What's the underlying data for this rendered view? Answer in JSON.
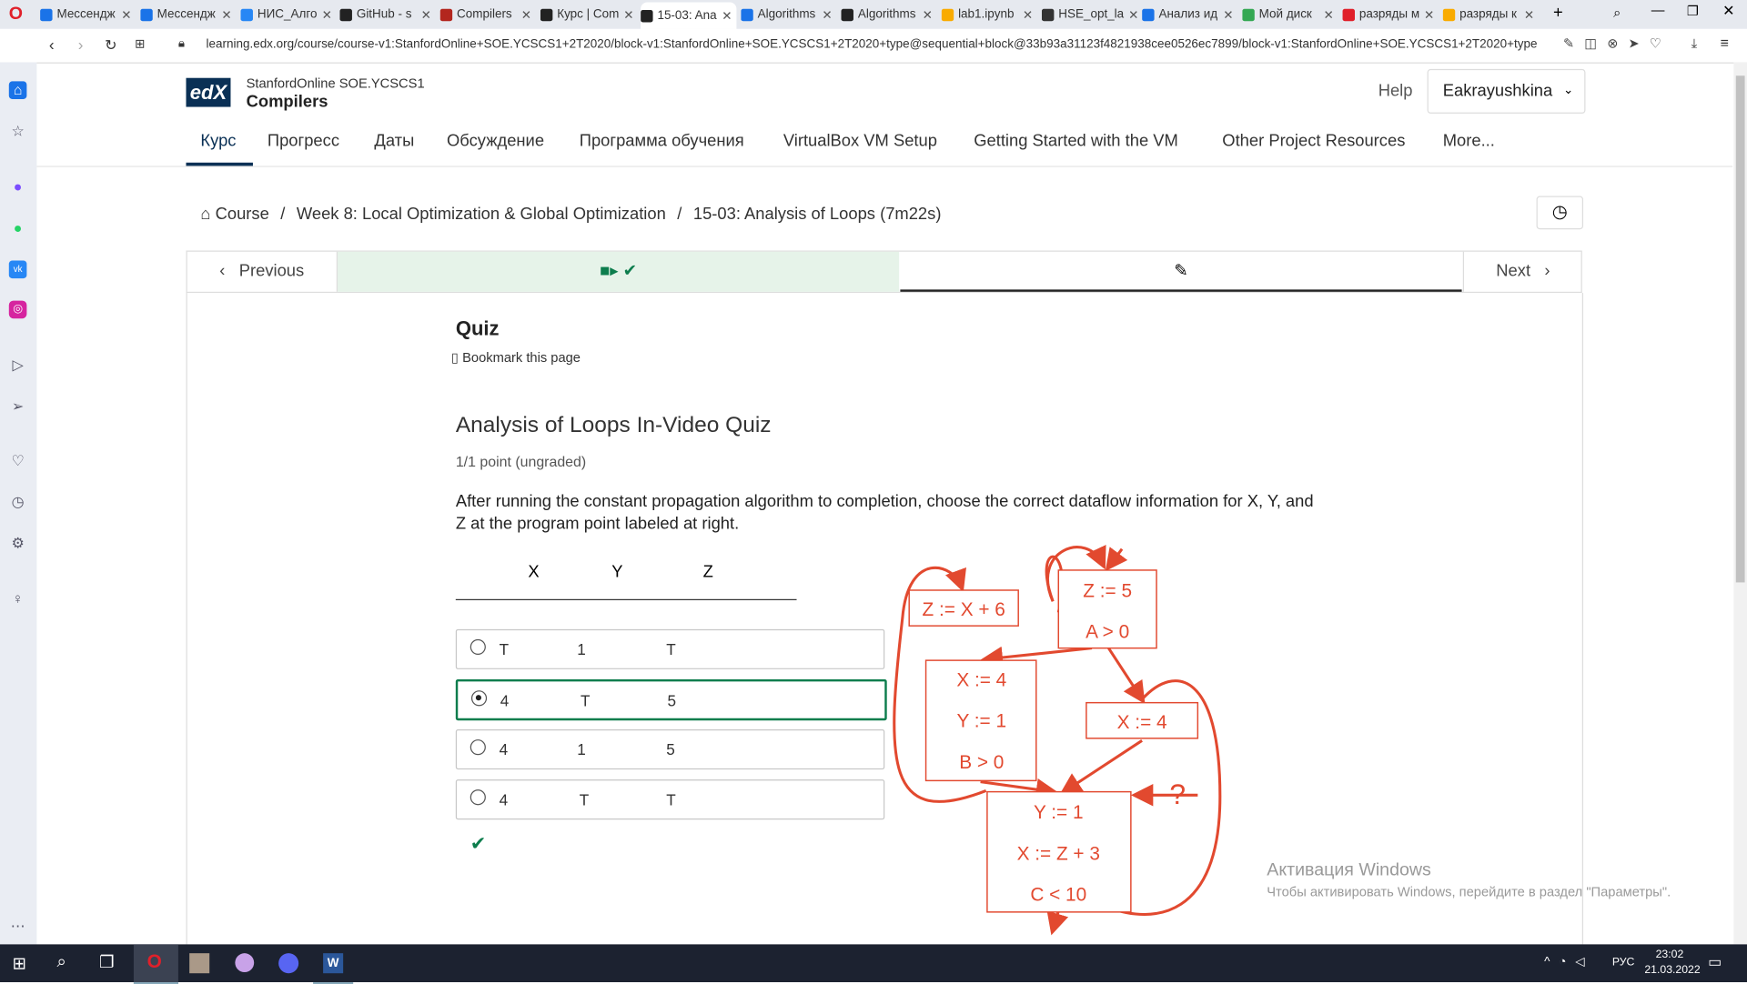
{
  "browser": {
    "tabs": [
      "Мессендж",
      "Мессендж",
      "НИС_Алго",
      "GitHub - s",
      "Compilers",
      "Курс | Com",
      "15-03: Ana",
      "Algorithms",
      "Algorithms",
      "lab1.ipynb",
      "HSE_opt_la",
      "Анализ ид",
      "Мой диск",
      "разряды м",
      "разряды к"
    ],
    "url": "learning.edx.org/course/course-v1:StanfordOnline+SOE.YCSCS1+2T2020/block-v1:StanfordOnline+SOE.YCSCS1+2T2020+type@sequential+block@33b93a31123f4821938cee0526ec7899/block-v1:StanfordOnline+SOE.YCSCS1+2T2020+type"
  },
  "header": {
    "logo": "edX",
    "org": "StanfordOnline SOE.YCSCS1",
    "course": "Compilers",
    "help": "Help",
    "user": "Eakrayushkina"
  },
  "nav": [
    "Курс",
    "Прогресс",
    "Даты",
    "Обсуждение",
    "Программа обучения",
    "VirtualBox VM Setup",
    "Getting Started with the VM",
    "Other Project Resources",
    "More..."
  ],
  "breadcrumb": {
    "home": "Course",
    "week": "Week 8: Local Optimization & Global Optimization",
    "unit": "15-03: Analysis of Loops (7m22s)"
  },
  "seq": {
    "prev": "Previous",
    "next": "Next"
  },
  "content": {
    "title": "Quiz",
    "bookmark": "Bookmark this page",
    "problem_title": "Analysis of Loops In-Video Quiz",
    "points": "1/1 point (ungraded)",
    "question": "After running the constant propagation algorithm to completion, choose the correct dataflow information for X, Y, and Z at the program point labeled at right.",
    "headers": [
      "X",
      "Y",
      "Z"
    ],
    "options": [
      [
        "T",
        "1",
        "T"
      ],
      [
        "4",
        "T",
        "5"
      ],
      [
        "4",
        "1",
        "5"
      ],
      [
        "4",
        "T",
        "T"
      ]
    ],
    "selected": 1
  },
  "diagram": {
    "b1": "Z := X + 6",
    "b2a": "Z := 5",
    "b2b": "A > 0",
    "b3a": "X := 4",
    "b3b": "Y := 1",
    "b3c": "B > 0",
    "b4": "X := 4",
    "b5a": "Y := 1",
    "b5b": "X := Z + 3",
    "b5c": "C < 10",
    "mark": "?"
  },
  "watermark": {
    "title": "Активация Windows",
    "sub": "Чтобы активировать Windows, перейдите в раздел \"Параметры\"."
  },
  "taskbar": {
    "lang": "РУС",
    "time": "23:02",
    "date": "21.03.2022"
  },
  "colors": {
    "accent": "#0d7d4d",
    "diagram": "#e2492f",
    "nav_active": "#0a3055"
  }
}
